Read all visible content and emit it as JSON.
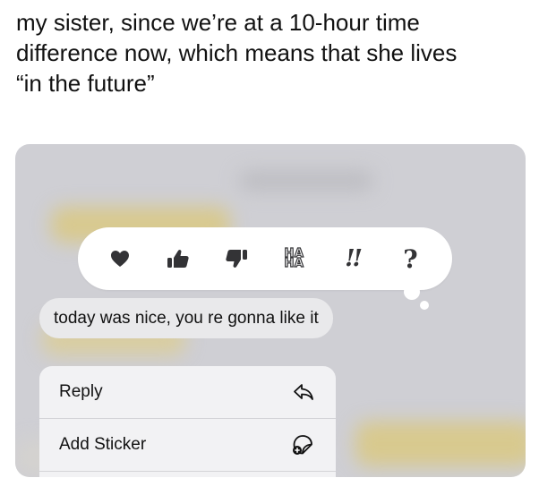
{
  "caption": {
    "line1": "my sister, since we’re at a 10-hour time",
    "line2": "difference now, which means that she lives",
    "line3": "“in the future”"
  },
  "tapbacks": {
    "items": [
      {
        "name": "heart",
        "icon": "heart-icon"
      },
      {
        "name": "thumbs-up",
        "icon": "thumbs-up-icon"
      },
      {
        "name": "thumbs-down",
        "icon": "thumbs-down-icon"
      },
      {
        "name": "haha",
        "icon": "haha-icon",
        "text_top": "HA",
        "text_bottom": "HA"
      },
      {
        "name": "emphasize",
        "icon": "double-exclamation-icon",
        "text": "!!"
      },
      {
        "name": "question",
        "icon": "question-mark-icon",
        "text": "?"
      }
    ]
  },
  "message": {
    "text": "today was nice, you re gonna like it"
  },
  "context_menu": {
    "items": [
      {
        "label": "Reply",
        "icon": "reply-arrow-icon"
      },
      {
        "label": "Add Sticker",
        "icon": "add-sticker-icon"
      }
    ]
  },
  "colors": {
    "background_blur": "#cfcfd4",
    "bubble": "#e9e9eb",
    "menu": "#f2f2f4",
    "tapback_icon": "#333336"
  }
}
